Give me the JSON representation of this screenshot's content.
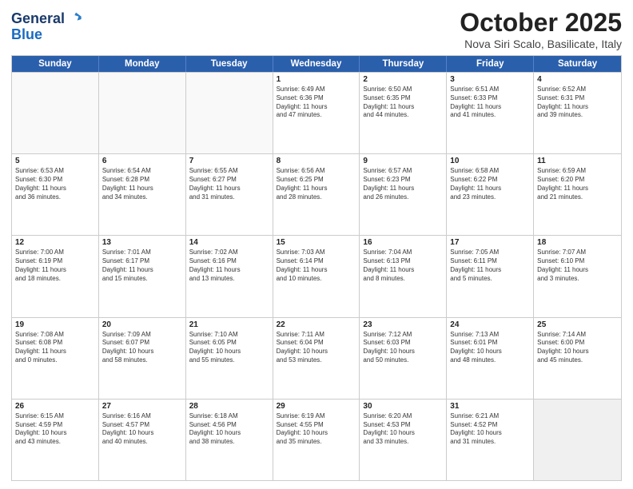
{
  "header": {
    "logo_line1": "General",
    "logo_line2": "Blue",
    "month": "October 2025",
    "location": "Nova Siri Scalo, Basilicate, Italy"
  },
  "days_of_week": [
    "Sunday",
    "Monday",
    "Tuesday",
    "Wednesday",
    "Thursday",
    "Friday",
    "Saturday"
  ],
  "rows": [
    [
      {
        "day": "",
        "text": ""
      },
      {
        "day": "",
        "text": ""
      },
      {
        "day": "",
        "text": ""
      },
      {
        "day": "1",
        "text": "Sunrise: 6:49 AM\nSunset: 6:36 PM\nDaylight: 11 hours\nand 47 minutes."
      },
      {
        "day": "2",
        "text": "Sunrise: 6:50 AM\nSunset: 6:35 PM\nDaylight: 11 hours\nand 44 minutes."
      },
      {
        "day": "3",
        "text": "Sunrise: 6:51 AM\nSunset: 6:33 PM\nDaylight: 11 hours\nand 41 minutes."
      },
      {
        "day": "4",
        "text": "Sunrise: 6:52 AM\nSunset: 6:31 PM\nDaylight: 11 hours\nand 39 minutes."
      }
    ],
    [
      {
        "day": "5",
        "text": "Sunrise: 6:53 AM\nSunset: 6:30 PM\nDaylight: 11 hours\nand 36 minutes."
      },
      {
        "day": "6",
        "text": "Sunrise: 6:54 AM\nSunset: 6:28 PM\nDaylight: 11 hours\nand 34 minutes."
      },
      {
        "day": "7",
        "text": "Sunrise: 6:55 AM\nSunset: 6:27 PM\nDaylight: 11 hours\nand 31 minutes."
      },
      {
        "day": "8",
        "text": "Sunrise: 6:56 AM\nSunset: 6:25 PM\nDaylight: 11 hours\nand 28 minutes."
      },
      {
        "day": "9",
        "text": "Sunrise: 6:57 AM\nSunset: 6:23 PM\nDaylight: 11 hours\nand 26 minutes."
      },
      {
        "day": "10",
        "text": "Sunrise: 6:58 AM\nSunset: 6:22 PM\nDaylight: 11 hours\nand 23 minutes."
      },
      {
        "day": "11",
        "text": "Sunrise: 6:59 AM\nSunset: 6:20 PM\nDaylight: 11 hours\nand 21 minutes."
      }
    ],
    [
      {
        "day": "12",
        "text": "Sunrise: 7:00 AM\nSunset: 6:19 PM\nDaylight: 11 hours\nand 18 minutes."
      },
      {
        "day": "13",
        "text": "Sunrise: 7:01 AM\nSunset: 6:17 PM\nDaylight: 11 hours\nand 15 minutes."
      },
      {
        "day": "14",
        "text": "Sunrise: 7:02 AM\nSunset: 6:16 PM\nDaylight: 11 hours\nand 13 minutes."
      },
      {
        "day": "15",
        "text": "Sunrise: 7:03 AM\nSunset: 6:14 PM\nDaylight: 11 hours\nand 10 minutes."
      },
      {
        "day": "16",
        "text": "Sunrise: 7:04 AM\nSunset: 6:13 PM\nDaylight: 11 hours\nand 8 minutes."
      },
      {
        "day": "17",
        "text": "Sunrise: 7:05 AM\nSunset: 6:11 PM\nDaylight: 11 hours\nand 5 minutes."
      },
      {
        "day": "18",
        "text": "Sunrise: 7:07 AM\nSunset: 6:10 PM\nDaylight: 11 hours\nand 3 minutes."
      }
    ],
    [
      {
        "day": "19",
        "text": "Sunrise: 7:08 AM\nSunset: 6:08 PM\nDaylight: 11 hours\nand 0 minutes."
      },
      {
        "day": "20",
        "text": "Sunrise: 7:09 AM\nSunset: 6:07 PM\nDaylight: 10 hours\nand 58 minutes."
      },
      {
        "day": "21",
        "text": "Sunrise: 7:10 AM\nSunset: 6:05 PM\nDaylight: 10 hours\nand 55 minutes."
      },
      {
        "day": "22",
        "text": "Sunrise: 7:11 AM\nSunset: 6:04 PM\nDaylight: 10 hours\nand 53 minutes."
      },
      {
        "day": "23",
        "text": "Sunrise: 7:12 AM\nSunset: 6:03 PM\nDaylight: 10 hours\nand 50 minutes."
      },
      {
        "day": "24",
        "text": "Sunrise: 7:13 AM\nSunset: 6:01 PM\nDaylight: 10 hours\nand 48 minutes."
      },
      {
        "day": "25",
        "text": "Sunrise: 7:14 AM\nSunset: 6:00 PM\nDaylight: 10 hours\nand 45 minutes."
      }
    ],
    [
      {
        "day": "26",
        "text": "Sunrise: 6:15 AM\nSunset: 4:59 PM\nDaylight: 10 hours\nand 43 minutes."
      },
      {
        "day": "27",
        "text": "Sunrise: 6:16 AM\nSunset: 4:57 PM\nDaylight: 10 hours\nand 40 minutes."
      },
      {
        "day": "28",
        "text": "Sunrise: 6:18 AM\nSunset: 4:56 PM\nDaylight: 10 hours\nand 38 minutes."
      },
      {
        "day": "29",
        "text": "Sunrise: 6:19 AM\nSunset: 4:55 PM\nDaylight: 10 hours\nand 35 minutes."
      },
      {
        "day": "30",
        "text": "Sunrise: 6:20 AM\nSunset: 4:53 PM\nDaylight: 10 hours\nand 33 minutes."
      },
      {
        "day": "31",
        "text": "Sunrise: 6:21 AM\nSunset: 4:52 PM\nDaylight: 10 hours\nand 31 minutes."
      },
      {
        "day": "",
        "text": ""
      }
    ]
  ]
}
